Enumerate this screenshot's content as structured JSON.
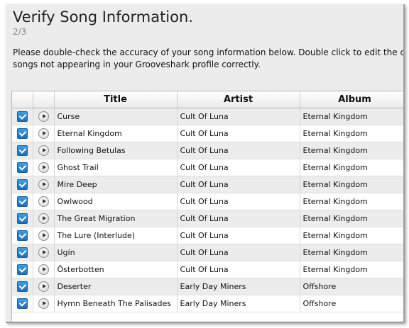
{
  "header": {
    "title": "Verify Song Information.",
    "step": "2/3",
    "instructions_line1": "Please double-check the accuracy of your song information below. Double click to edit the cell.",
    "instructions_line2": "songs not appearing in your Grooveshark profile correctly."
  },
  "table": {
    "columns": [
      "",
      "",
      "Title",
      "Artist",
      "Album"
    ],
    "rows": [
      {
        "checked": true,
        "title": "Curse",
        "artist": "Cult Of Luna",
        "album": "Eternal Kingdom"
      },
      {
        "checked": true,
        "title": "Eternal Kingdom",
        "artist": "Cult Of Luna",
        "album": "Eternal Kingdom"
      },
      {
        "checked": true,
        "title": "Following Betulas",
        "artist": "Cult Of Luna",
        "album": "Eternal Kingdom"
      },
      {
        "checked": true,
        "title": "Ghost Trail",
        "artist": "Cult Of Luna",
        "album": "Eternal Kingdom"
      },
      {
        "checked": true,
        "title": "Mire Deep",
        "artist": "Cult Of Luna",
        "album": "Eternal Kingdom"
      },
      {
        "checked": true,
        "title": "Owlwood",
        "artist": "Cult Of Luna",
        "album": "Eternal Kingdom"
      },
      {
        "checked": true,
        "title": "The Great Migration",
        "artist": "Cult Of Luna",
        "album": "Eternal Kingdom"
      },
      {
        "checked": true,
        "title": "The Lure (Interlude)",
        "artist": "Cult Of Luna",
        "album": "Eternal Kingdom"
      },
      {
        "checked": true,
        "title": "Ugín",
        "artist": "Cult Of Luna",
        "album": "Eternal Kingdom"
      },
      {
        "checked": true,
        "title": "Österbotten",
        "artist": "Cult Of Luna",
        "album": "Eternal Kingdom"
      },
      {
        "checked": true,
        "title": "Deserter",
        "artist": "Early Day Miners",
        "album": "Offshore"
      },
      {
        "checked": true,
        "title": "Hymn Beneath The Palisades",
        "artist": "Early Day Miners",
        "album": "Offshore"
      }
    ]
  },
  "icons": {
    "checkbox": "checkbox-checked-icon",
    "play": "play-icon"
  },
  "colors": {
    "checkbox": "#2a86d0",
    "row_alt": "#ececec",
    "panel_bg": "#ececec"
  }
}
